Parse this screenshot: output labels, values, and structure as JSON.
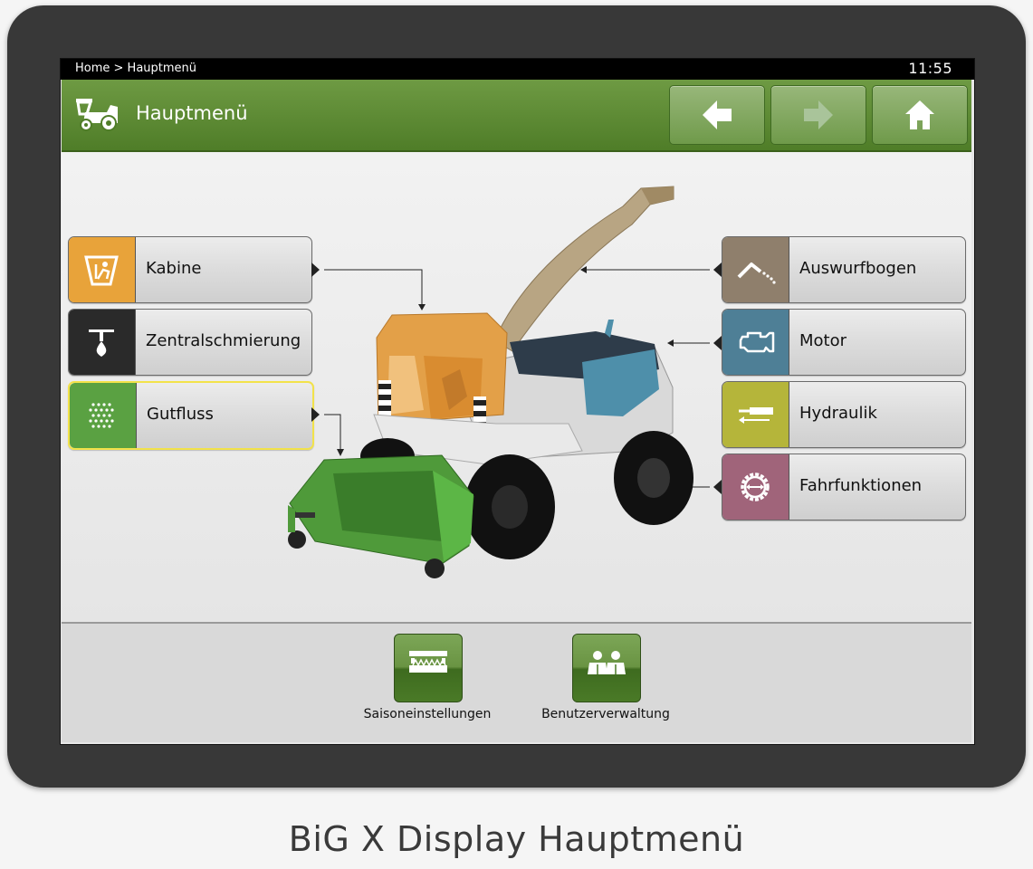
{
  "statusbar": {
    "breadcrumb": "Home > Hauptmenü",
    "time": "11:55"
  },
  "header": {
    "title": "Hauptmenü",
    "icon": "forage-harvester-icon",
    "nav": [
      {
        "name": "back",
        "icon": "arrow-left-icon"
      },
      {
        "name": "forward",
        "icon": "arrow-right-icon",
        "disabled": true
      },
      {
        "name": "home",
        "icon": "home-icon"
      }
    ]
  },
  "left_menu": [
    {
      "id": "kabine",
      "label": "Kabine",
      "icon": "cab-seat-icon",
      "color": "#e8a33a"
    },
    {
      "id": "zentralschmierung",
      "label": "Zentralschmierung",
      "icon": "lubrication-drop-icon",
      "color": "#2a2a2a"
    },
    {
      "id": "gutfluss",
      "label": "Gutfluss",
      "icon": "crop-flow-icon",
      "color": "#5aa142",
      "selected": true
    }
  ],
  "right_menu": [
    {
      "id": "auswurfbogen",
      "label": "Auswurfbogen",
      "icon": "spout-icon",
      "color": "#8f7f6c"
    },
    {
      "id": "motor",
      "label": "Motor",
      "icon": "engine-icon",
      "color": "#4e7f96"
    },
    {
      "id": "hydraulik",
      "label": "Hydraulik",
      "icon": "hydraulic-cylinder-icon",
      "color": "#b5b53a"
    },
    {
      "id": "fahrfunktionen",
      "label": "Fahrfunktionen",
      "icon": "drive-gear-icon",
      "color": "#a0647a"
    }
  ],
  "bottom": [
    {
      "id": "saison",
      "label": "Saisoneinstellungen",
      "icon": "season-settings-icon"
    },
    {
      "id": "benutzer",
      "label": "Benutzerverwaltung",
      "icon": "users-icon"
    }
  ],
  "caption": "BiG X Display Hauptmenü"
}
